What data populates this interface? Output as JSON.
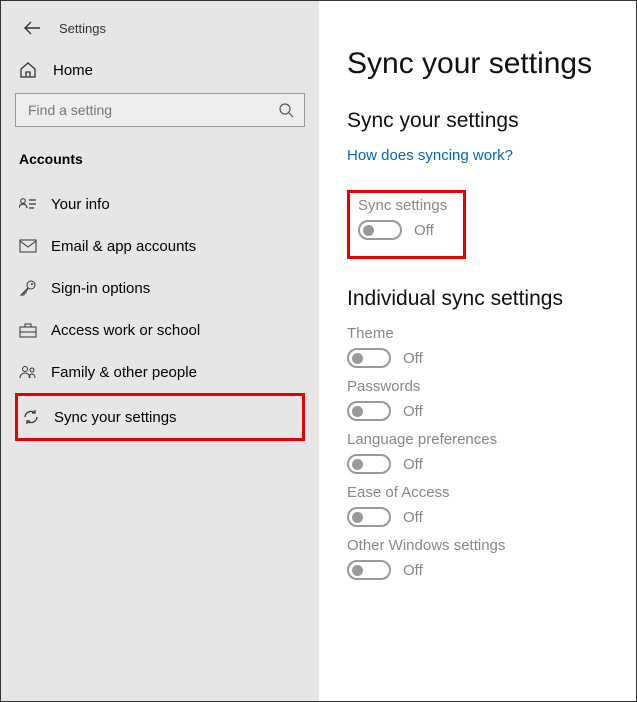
{
  "header": {
    "app_title": "Settings"
  },
  "sidebar": {
    "home_label": "Home",
    "search_placeholder": "Find a setting",
    "section_label": "Accounts",
    "items": [
      {
        "label": "Your info"
      },
      {
        "label": "Email & app accounts"
      },
      {
        "label": "Sign-in options"
      },
      {
        "label": "Access work or school"
      },
      {
        "label": "Family & other people"
      },
      {
        "label": "Sync your settings"
      }
    ]
  },
  "main": {
    "page_title": "Sync your settings",
    "section1_title": "Sync your settings",
    "help_link": "How does syncing work?",
    "master": {
      "label": "Sync settings",
      "state": "Off"
    },
    "section2_title": "Individual sync settings",
    "options": [
      {
        "label": "Theme",
        "state": "Off"
      },
      {
        "label": "Passwords",
        "state": "Off"
      },
      {
        "label": "Language preferences",
        "state": "Off"
      },
      {
        "label": "Ease of Access",
        "state": "Off"
      },
      {
        "label": "Other Windows settings",
        "state": "Off"
      }
    ]
  }
}
